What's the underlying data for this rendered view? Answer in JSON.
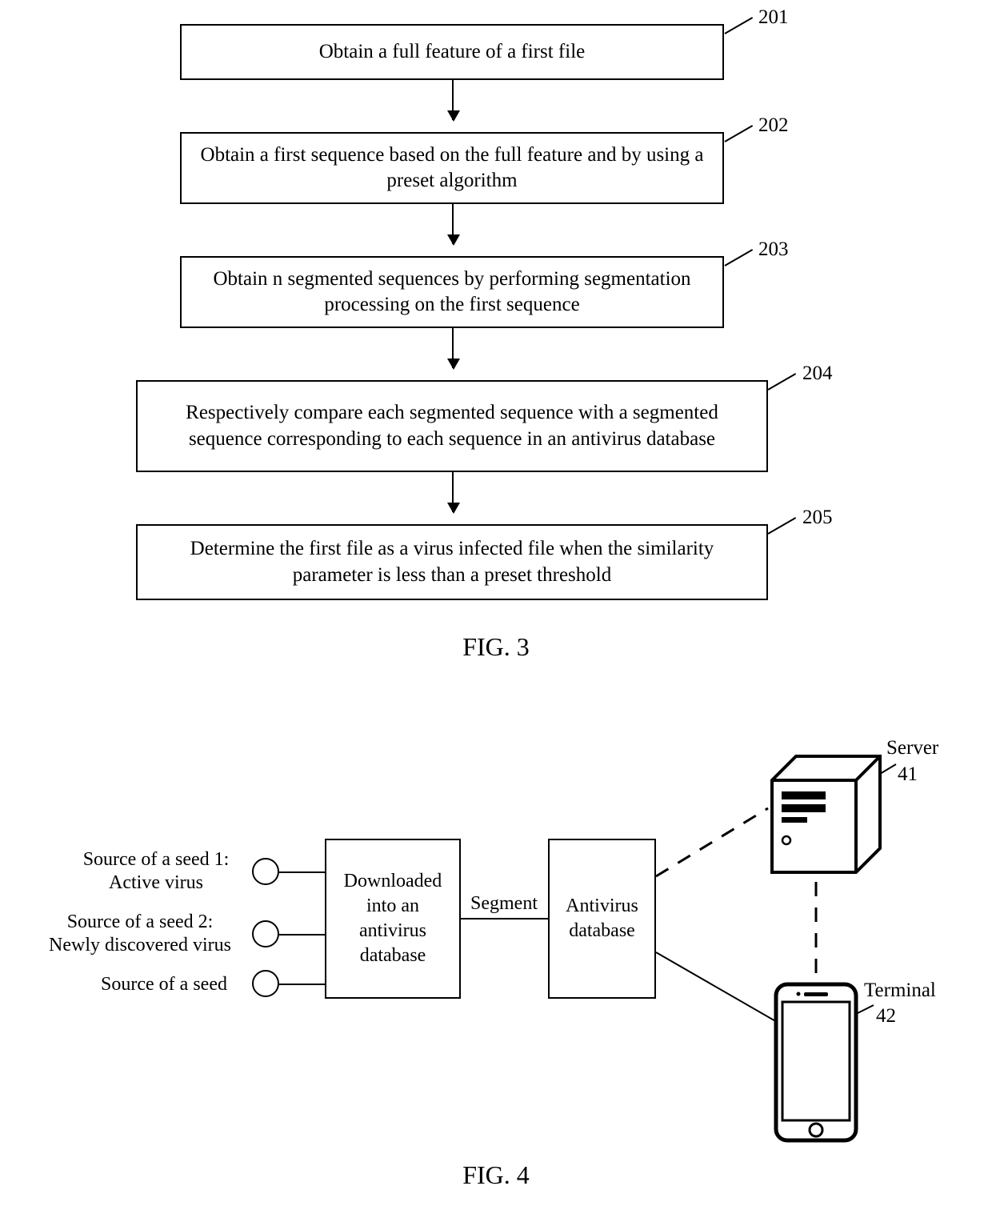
{
  "fig3": {
    "steps": [
      {
        "ref": "201",
        "text": "Obtain a full feature of a first file"
      },
      {
        "ref": "202",
        "text": "Obtain a first sequence based on the full feature and by using a preset algorithm"
      },
      {
        "ref": "203",
        "text": "Obtain n segmented sequences by performing segmentation processing on the first sequence"
      },
      {
        "ref": "204",
        "text": "Respectively compare each segmented sequence with a segmented sequence corresponding to each sequence in an antivirus database"
      },
      {
        "ref": "205",
        "text": "Determine the first file as a virus infected file when the similarity parameter is less than a preset threshold"
      }
    ],
    "caption": "FIG. 3"
  },
  "fig4": {
    "seeds": [
      {
        "line1": "Source of a seed 1:",
        "line2": "Active virus"
      },
      {
        "line1": "Source of a seed 2:",
        "line2": "Newly discovered virus"
      },
      {
        "line1": "Source of a seed",
        "line2": ""
      }
    ],
    "download_box": "Downloaded into an antivirus database",
    "segment_label": "Segment",
    "antivirus_db": "Antivirus database",
    "server": {
      "label": "Server",
      "ref": "41"
    },
    "terminal": {
      "label": "Terminal",
      "ref": "42"
    },
    "caption": "FIG. 4"
  }
}
